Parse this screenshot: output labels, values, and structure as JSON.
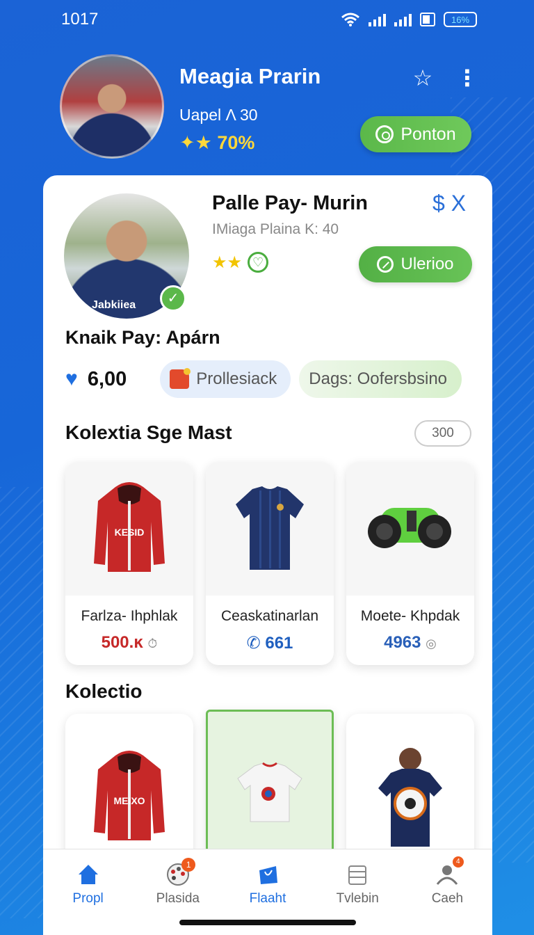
{
  "status_bar": {
    "time": "1017",
    "battery": "16%"
  },
  "header": {
    "name": "Meagia Prarin",
    "subtitle": "Uapel Λ 30",
    "rating": "✦★ 70%",
    "action_button": "Ponton"
  },
  "profile_card": {
    "name": "Palle Pay- Murin",
    "subtitle": "IMiaga Plaina K: 40",
    "top_right": "$ X",
    "action_button": "Ulerioo",
    "jersey_text": "Jabkiiea",
    "section_title": "Knaik Pay: Apárn",
    "likes": "6,00",
    "chip_one": "Prollesiack",
    "chip_two": "Dags: Oofersbsino"
  },
  "collection_one": {
    "title": "Kolextia Sge Mast",
    "count": "300",
    "items": [
      {
        "name": "Farlza- Ihphlak",
        "price": "500.ĸ",
        "price_color": "#c62828",
        "price_icon": "timer-icon",
        "image_text": "KESID"
      },
      {
        "name": "Ceaskatinarlan",
        "price": "661",
        "price_color": "#1f5fbf",
        "price_icon": "phone-icon"
      },
      {
        "name": "Moete- Khpdak",
        "price": "4963",
        "price_color": "#2a60b8",
        "price_icon": "coin-icon"
      }
    ]
  },
  "collection_two": {
    "title": "Kolectio",
    "items": [
      {
        "image_text": "MEIXO"
      },
      {
        "selected": true
      },
      {}
    ]
  },
  "bottom_nav": [
    {
      "label": "Propl",
      "icon": "home-icon",
      "active": true
    },
    {
      "label": "Plasida",
      "icon": "palette-icon",
      "badge": "1"
    },
    {
      "label": "Flaaht",
      "icon": "bag-icon",
      "active": true
    },
    {
      "label": "Tvlebin",
      "icon": "box-icon"
    },
    {
      "label": "Caeh",
      "icon": "person-icon",
      "badge": "4"
    }
  ],
  "colors": {
    "brand_blue": "#1b63d6",
    "accent_green": "#5bb84a",
    "accent_yellow": "#ffd83a"
  }
}
